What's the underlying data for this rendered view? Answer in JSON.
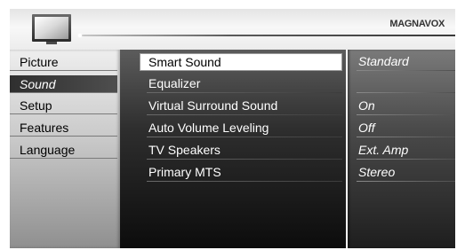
{
  "header": {
    "brand": "MAGNAVOX",
    "icon": "tv-icon"
  },
  "left_menu": {
    "items": [
      {
        "label": "Picture"
      },
      {
        "label": "Sound",
        "active": true
      },
      {
        "label": "Setup"
      },
      {
        "label": "Features"
      },
      {
        "label": "Language"
      }
    ]
  },
  "sound_menu": {
    "items": [
      {
        "label": "Smart Sound",
        "value": "Standard",
        "selected": true
      },
      {
        "label": "Equalizer",
        "value": ""
      },
      {
        "label": "Virtual Surround Sound",
        "value": "On"
      },
      {
        "label": "Auto Volume Leveling",
        "value": "Off"
      },
      {
        "label": "TV Speakers",
        "value": "Ext. Amp"
      },
      {
        "label": "Primary MTS",
        "value": "Stereo"
      }
    ]
  },
  "colors": {
    "selection_bg": "#ffffff",
    "active_tab_bg": "#3a3a3a",
    "menu_text": "#ffffff"
  }
}
